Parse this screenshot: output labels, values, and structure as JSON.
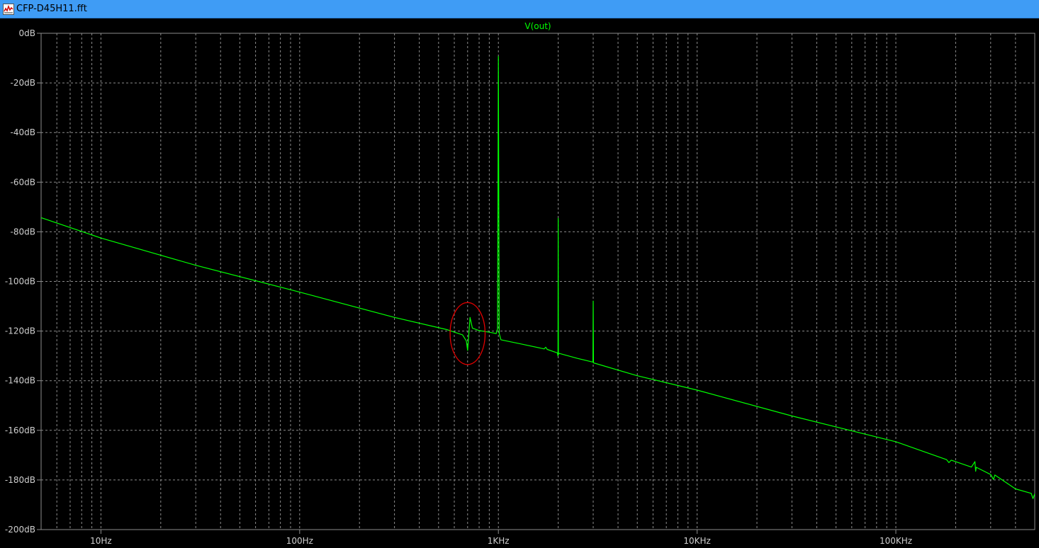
{
  "window": {
    "title": "CFP-D45H11.fft",
    "icon": "waveform-icon"
  },
  "colors": {
    "background": "#000000",
    "grid": "#8c8c8c",
    "trace": "#00ff00",
    "annotation_circle": "#e00000",
    "titlebar": "#3f9cf5"
  },
  "chart_data": {
    "type": "line",
    "title": "V(out)",
    "xscale": "log",
    "xlim": [
      5,
      500000
    ],
    "ylim": [
      -200,
      0
    ],
    "grid": true,
    "x_ticks": [
      {
        "value": 10,
        "label": "10Hz"
      },
      {
        "value": 100,
        "label": "100Hz"
      },
      {
        "value": 1000,
        "label": "1KHz"
      },
      {
        "value": 10000,
        "label": "10KHz"
      },
      {
        "value": 100000,
        "label": "100KHz"
      }
    ],
    "y_ticks": [
      {
        "value": 0,
        "label": "0dB"
      },
      {
        "value": -20,
        "label": "-20dB"
      },
      {
        "value": -40,
        "label": "-40dB"
      },
      {
        "value": -60,
        "label": "-60dB"
      },
      {
        "value": -80,
        "label": "-80dB"
      },
      {
        "value": -100,
        "label": "-100dB"
      },
      {
        "value": -120,
        "label": "-120dB"
      },
      {
        "value": -140,
        "label": "-140dB"
      },
      {
        "value": -160,
        "label": "-160dB"
      },
      {
        "value": -180,
        "label": "-180dB"
      },
      {
        "value": -200,
        "label": "-200dB"
      }
    ],
    "series": [
      {
        "name": "V(out)",
        "points": [
          [
            5,
            -74.3
          ],
          [
            10,
            -82.5
          ],
          [
            30,
            -93.5
          ],
          [
            100,
            -104.3
          ],
          [
            300,
            -114.5
          ],
          [
            550,
            -119.4
          ],
          [
            620,
            -120.8
          ],
          [
            660,
            -121.5
          ],
          [
            690,
            -124.0
          ],
          [
            700,
            -127.8
          ],
          [
            720,
            -114.5
          ],
          [
            740,
            -118.8
          ],
          [
            800,
            -119.8
          ],
          [
            860,
            -120.2
          ],
          [
            920,
            -120.6
          ],
          [
            975,
            -121.0
          ],
          [
            990,
            -119.0
          ],
          [
            1000,
            -9.4
          ],
          [
            1010,
            -121.0
          ],
          [
            1030,
            -123.5
          ],
          [
            1300,
            -125.2
          ],
          [
            1700,
            -127.2
          ],
          [
            1730,
            -126.5
          ],
          [
            1760,
            -127.4
          ],
          [
            1980,
            -128.8
          ],
          [
            1995,
            -130.0
          ],
          [
            2000,
            -74.6
          ],
          [
            2005,
            -129.5
          ],
          [
            2020,
            -129.0
          ],
          [
            2500,
            -131.0
          ],
          [
            2990,
            -132.5
          ],
          [
            3000,
            -107.9
          ],
          [
            3010,
            -132.8
          ],
          [
            5000,
            -138.0
          ],
          [
            10000,
            -143.8
          ],
          [
            30000,
            -154.2
          ],
          [
            100000,
            -164.6
          ],
          [
            180000,
            -171.8
          ],
          [
            185000,
            -173.0
          ],
          [
            190000,
            -172.0
          ],
          [
            240000,
            -174.8
          ],
          [
            250000,
            -172.6
          ],
          [
            252000,
            -176.5
          ],
          [
            254000,
            -174.9
          ],
          [
            300000,
            -177.8
          ],
          [
            310000,
            -179.8
          ],
          [
            315000,
            -178.0
          ],
          [
            400000,
            -183.6
          ],
          [
            480000,
            -185.4
          ],
          [
            490000,
            -187.5
          ],
          [
            500000,
            -185.6
          ]
        ]
      }
    ],
    "annotations": [
      {
        "shape": "ellipse",
        "x_center": 700,
        "y_center": -121,
        "x_range": [
          580,
          870
        ],
        "y_range": [
          -133,
          -108
        ]
      }
    ]
  }
}
